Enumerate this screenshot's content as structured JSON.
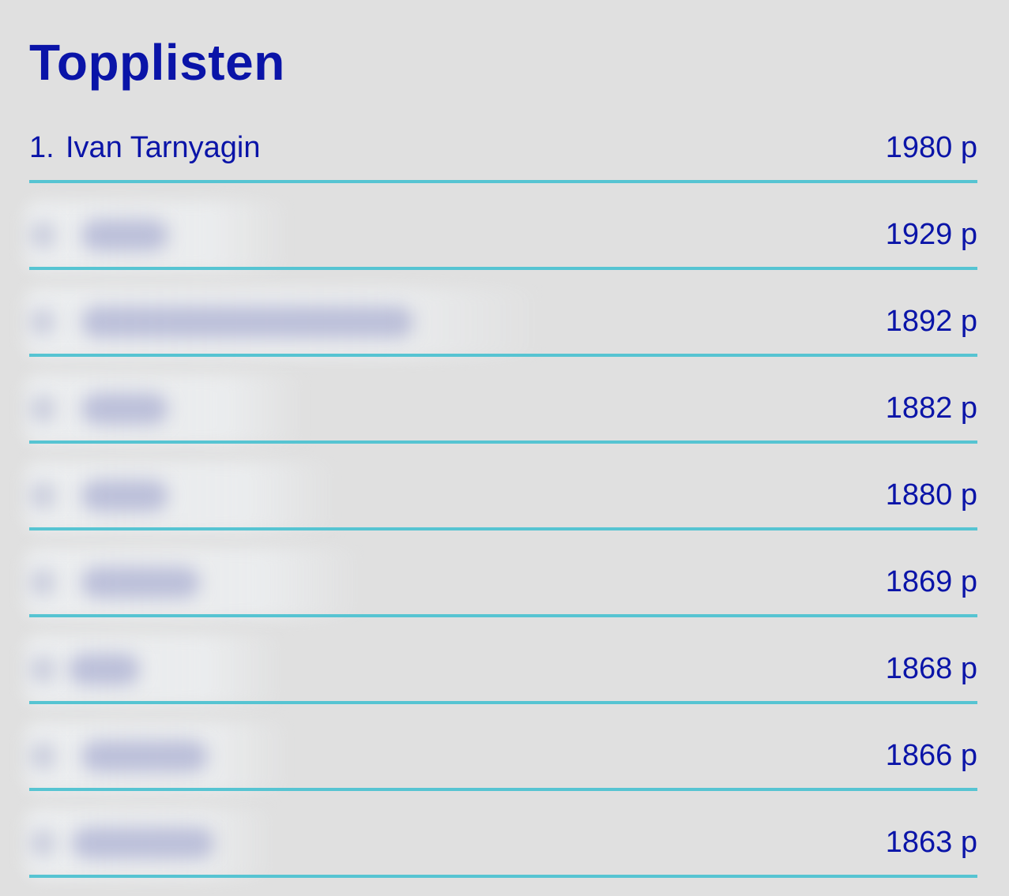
{
  "header": {
    "title": "Topplisten"
  },
  "leaderboard": [
    {
      "rank": "1.",
      "name": "Ivan Tarnyagin",
      "score": "1980 p",
      "name_hidden": false
    },
    {
      "rank": "",
      "name": "",
      "score": "1929 p",
      "name_hidden": true
    },
    {
      "rank": "",
      "name": "",
      "score": "1892 p",
      "name_hidden": true
    },
    {
      "rank": "",
      "name": "",
      "score": "1882 p",
      "name_hidden": true
    },
    {
      "rank": "",
      "name": "",
      "score": "1880 p",
      "name_hidden": true
    },
    {
      "rank": "",
      "name": "",
      "score": "1869 p",
      "name_hidden": true
    },
    {
      "rank": "",
      "name": "",
      "score": "1868 p",
      "name_hidden": true
    },
    {
      "rank": "",
      "name": "",
      "score": "1866 p",
      "name_hidden": true
    },
    {
      "rank": "",
      "name": "",
      "score": "1863 p",
      "name_hidden": true
    }
  ],
  "colors": {
    "background": "#e0e0e0",
    "text": "#0a14a8",
    "divider": "#56c4d2"
  }
}
